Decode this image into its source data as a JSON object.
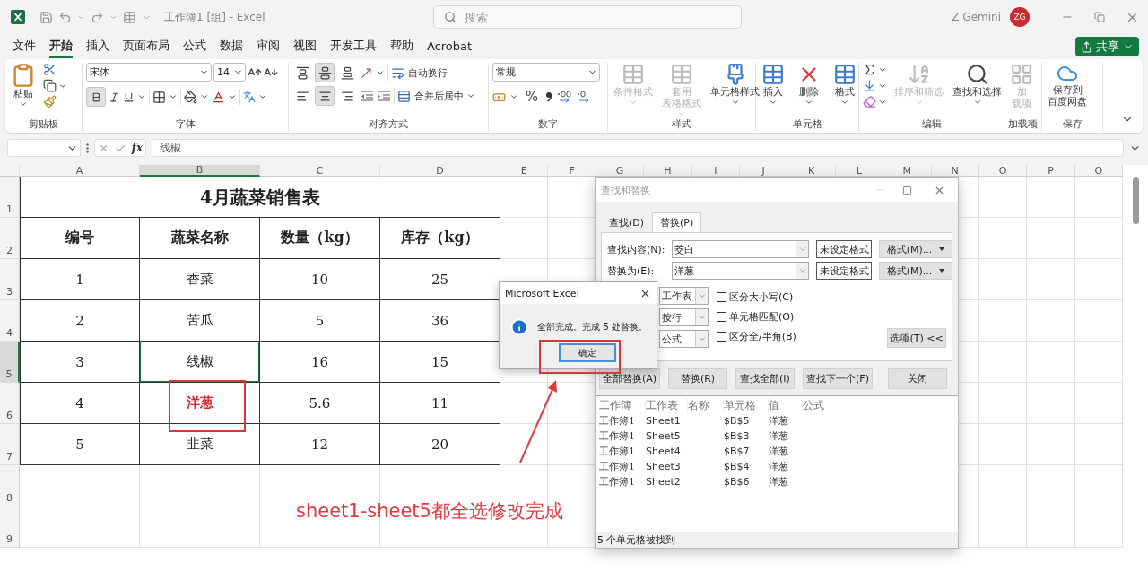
{
  "title_bar": {
    "title": "工作簿1 [组] - Excel",
    "search_placeholder": "搜索",
    "user_name": "Z Gemini",
    "avatar_initials": "ZG"
  },
  "menu_tabs": [
    {
      "label": "文件",
      "selected": false
    },
    {
      "label": "开始",
      "selected": true
    },
    {
      "label": "插入",
      "selected": false
    },
    {
      "label": "页面布局",
      "selected": false
    },
    {
      "label": "公式",
      "selected": false
    },
    {
      "label": "数据",
      "selected": false
    },
    {
      "label": "审阅",
      "selected": false
    },
    {
      "label": "视图",
      "selected": false
    },
    {
      "label": "开发工具",
      "selected": false
    },
    {
      "label": "帮助",
      "selected": false
    },
    {
      "label": "Acrobat",
      "selected": false
    }
  ],
  "share_button": {
    "label": "共享"
  },
  "ribbon": {
    "clipboard": {
      "label": "剪贴板",
      "paste": "粘贴"
    },
    "font": {
      "label": "字体",
      "font_name": "宋体",
      "font_size": "14",
      "bold": true
    },
    "alignment": {
      "label": "对齐方式",
      "vertical": [
        {
          "selected": false
        },
        {
          "selected": true
        },
        {
          "selected": false
        }
      ],
      "horizontal": [
        {
          "selected": false
        },
        {
          "selected": true
        },
        {
          "selected": false
        }
      ],
      "wrap_text": "自动换行",
      "merge": "合并后居中"
    },
    "number": {
      "label": "数字",
      "format": "常规",
      "percent": "%"
    },
    "styles": {
      "label": "样式",
      "buttons": [
        {
          "lines": [
            "条件格式"
          ],
          "disabled": true
        },
        {
          "lines": [
            "套用",
            "表格格式"
          ],
          "disabled": true
        },
        {
          "lines": [
            "单元格样式"
          ],
          "disabled": false
        }
      ]
    },
    "cells": {
      "label": "单元格",
      "buttons": [
        {
          "label": "插入"
        },
        {
          "label": "删除"
        },
        {
          "label": "格式"
        }
      ]
    },
    "editing": {
      "label": "编辑",
      "buttons": [
        {
          "lines": [
            "排序和筛选"
          ],
          "disabled": true
        },
        {
          "lines": [
            "查找和选择"
          ],
          "disabled": false
        }
      ]
    },
    "addins": {
      "label": "加载项",
      "lines": [
        "加",
        "载项"
      ],
      "disabled": true
    },
    "save": {
      "label": "保存",
      "lines": [
        "保存到",
        "百度网盘"
      ]
    }
  },
  "formula_bar": {
    "function_label": "fx",
    "formula": "线椒"
  },
  "sheet": {
    "columns": [
      {
        "label": "A",
        "selected": false
      },
      {
        "label": "B",
        "selected": true
      },
      {
        "label": "C",
        "selected": false
      },
      {
        "label": "D",
        "selected": false
      },
      {
        "label": "E",
        "selected": false
      },
      {
        "label": "F",
        "selected": false
      },
      {
        "label": "G",
        "selected": false
      },
      {
        "label": "H",
        "selected": false
      },
      {
        "label": "I",
        "selected": false
      },
      {
        "label": "J",
        "selected": false
      },
      {
        "label": "K",
        "selected": false
      },
      {
        "label": "L",
        "selected": false
      },
      {
        "label": "M",
        "selected": false
      },
      {
        "label": "N",
        "selected": false
      },
      {
        "label": "O",
        "selected": false
      },
      {
        "label": "P",
        "selected": false
      },
      {
        "label": "Q",
        "selected": false
      }
    ],
    "rows": [
      {
        "label": "1",
        "selected": false
      },
      {
        "label": "2",
        "selected": false
      },
      {
        "label": "3",
        "selected": false
      },
      {
        "label": "4",
        "selected": false
      },
      {
        "label": "5",
        "selected": true
      },
      {
        "label": "6",
        "selected": false
      },
      {
        "label": "7",
        "selected": false
      },
      {
        "label": "8",
        "selected": false
      },
      {
        "label": "9",
        "selected": false
      }
    ],
    "table": {
      "title": "4月蔬菜销售表",
      "headers": [
        "编号",
        "蔬菜名称",
        "数量（kg）",
        "库存（kg）"
      ],
      "rows": [
        {
          "cells": [
            {
              "text": "1",
              "selected": false,
              "highlight": false
            },
            {
              "text": "香菜",
              "selected": false,
              "highlight": false
            },
            {
              "text": "10",
              "selected": false,
              "highlight": false
            },
            {
              "text": "25",
              "selected": false,
              "highlight": false
            }
          ]
        },
        {
          "cells": [
            {
              "text": "2",
              "selected": false,
              "highlight": false
            },
            {
              "text": "苦瓜",
              "selected": false,
              "highlight": false
            },
            {
              "text": "5",
              "selected": false,
              "highlight": false
            },
            {
              "text": "36",
              "selected": false,
              "highlight": false
            }
          ]
        },
        {
          "cells": [
            {
              "text": "3",
              "selected": false,
              "highlight": false
            },
            {
              "text": "线椒",
              "selected": true,
              "highlight": false
            },
            {
              "text": "16",
              "selected": false,
              "highlight": false
            },
            {
              "text": "15",
              "selected": false,
              "highlight": false
            }
          ]
        },
        {
          "cells": [
            {
              "text": "4",
              "selected": false,
              "highlight": false
            },
            {
              "text": "洋葱",
              "selected": false,
              "highlight": true
            },
            {
              "text": "5.6",
              "selected": false,
              "highlight": false
            },
            {
              "text": "11",
              "selected": false,
              "highlight": false
            }
          ]
        },
        {
          "cells": [
            {
              "text": "5",
              "selected": false,
              "highlight": false
            },
            {
              "text": "韭菜",
              "selected": false,
              "highlight": false
            },
            {
              "text": "12",
              "selected": false,
              "highlight": false
            },
            {
              "text": "20",
              "selected": false,
              "highlight": false
            }
          ]
        }
      ]
    }
  },
  "annotation": {
    "text": "sheet1-sheet5都全选修改完成"
  },
  "find_dialog": {
    "title": "查找和替换",
    "tabs": [
      {
        "label": "查找(D)",
        "selected": false
      },
      {
        "label": "替换(P)",
        "selected": true
      }
    ],
    "fields": [
      {
        "label": "查找内容(N):",
        "value": "茭白",
        "format_preview": "未设定格式",
        "format_button": "格式(M)..."
      },
      {
        "label": "替换为(E):",
        "value": "洋葱",
        "format_preview": "未设定格式",
        "format_button": "格式(M)..."
      }
    ],
    "options": [
      "工作表",
      "按行",
      "公式"
    ],
    "checkboxes": [
      {
        "label": "区分大小写(C)",
        "checked": false
      },
      {
        "label": "单元格匹配(O)",
        "checked": false
      },
      {
        "label": "区分全/半角(B)",
        "checked": false
      }
    ],
    "options_button": "选项(T) <<",
    "buttons": [
      "全部替换(A)",
      "替换(R)",
      "查找全部(I)",
      "查找下一个(F)",
      "关闭"
    ],
    "results": {
      "columns": [
        "工作簿",
        "工作表",
        "名称",
        "单元格",
        "值",
        "公式"
      ],
      "rows": [
        {
          "book": "工作簿1",
          "sheet": "Sheet1",
          "cell": "$B$5",
          "value": "洋葱"
        },
        {
          "book": "工作簿1",
          "sheet": "Sheet5",
          "cell": "$B$3",
          "value": "洋葱"
        },
        {
          "book": "工作簿1",
          "sheet": "Sheet4",
          "cell": "$B$7",
          "value": "洋葱"
        },
        {
          "book": "工作簿1",
          "sheet": "Sheet3",
          "cell": "$B$4",
          "value": "洋葱"
        },
        {
          "book": "工作簿1",
          "sheet": "Sheet2",
          "cell": "$B$6",
          "value": "洋葱"
        }
      ]
    },
    "status": "5 个单元格被找到"
  },
  "message_box": {
    "title": "Microsoft Excel",
    "message": "全部完成。完成 5 处替换。",
    "button": "确定"
  }
}
